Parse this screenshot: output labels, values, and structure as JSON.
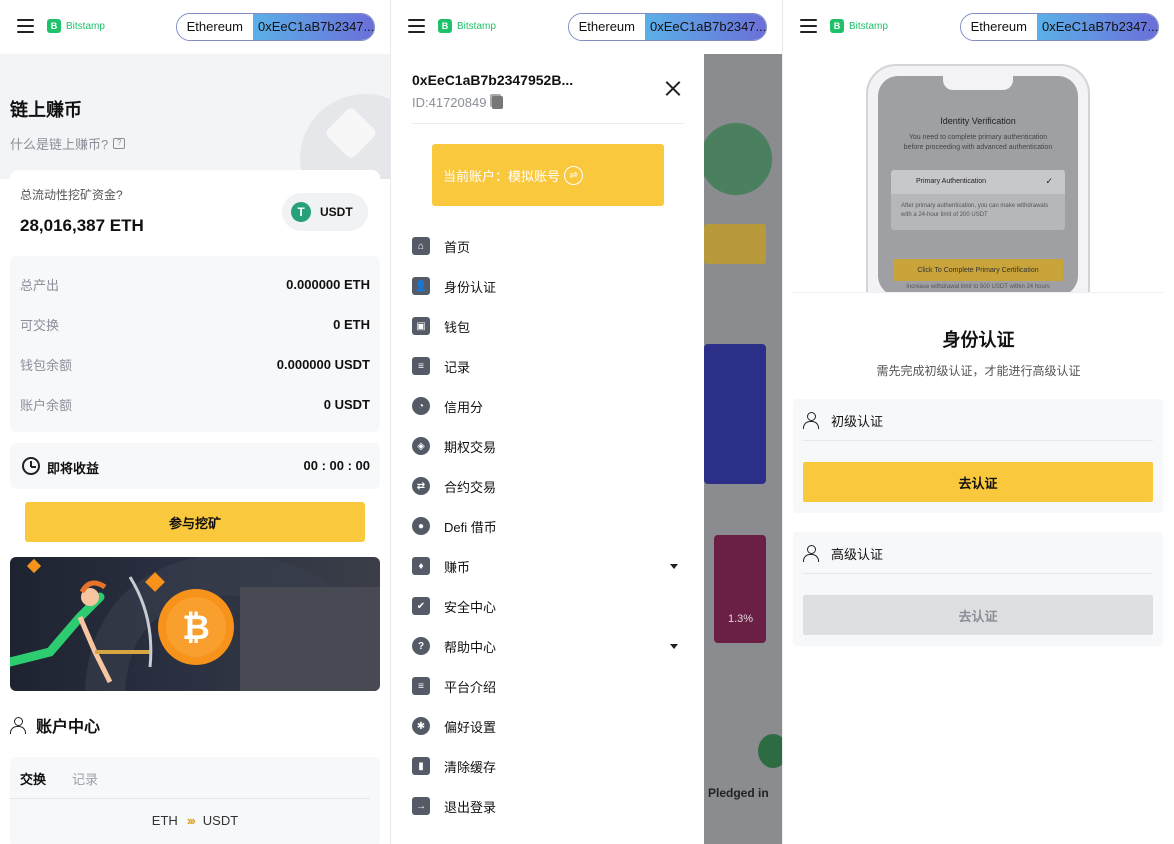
{
  "header": {
    "brand": "Bitstamp",
    "network": "Ethereum",
    "address_short": "0xEeC1aB7b2347..."
  },
  "mining": {
    "title": "链上赚币",
    "subtitle": "什么是链上赚币?",
    "pool_label": "总流动性挖矿资金?",
    "pool_value": "28,016,387 ETH",
    "coin": "USDT",
    "stats": [
      {
        "label": "总产出",
        "value": "0.000000 ETH"
      },
      {
        "label": "可交换",
        "value": "0 ETH"
      },
      {
        "label": "钱包余额",
        "value": "0.000000 USDT"
      },
      {
        "label": "账户余额",
        "value": "0 USDT"
      }
    ],
    "earn_label": "即将收益",
    "earn_timer": "00 : 00 : 00",
    "join_button": "参与挖矿",
    "account_center": "账户中心",
    "tabs": [
      "交换",
      "记录"
    ],
    "pair_from": "ETH",
    "pair_to": "USDT"
  },
  "drawer": {
    "address": "0xEeC1aB7b2347952B...",
    "id_text": "ID:41720849",
    "current_account": "当前账户：模拟账号",
    "menu": [
      {
        "label": "首页",
        "icon": "home-icon",
        "glyph": "⌂"
      },
      {
        "label": "身份认证",
        "icon": "identity-icon",
        "glyph": "👤"
      },
      {
        "label": "钱包",
        "icon": "wallet-icon",
        "glyph": "▣"
      },
      {
        "label": "记录",
        "icon": "record-icon",
        "glyph": "≡"
      },
      {
        "label": "信用分",
        "icon": "credit-gauge-icon",
        "glyph": "◔"
      },
      {
        "label": "期权交易",
        "icon": "options-icon",
        "glyph": "◈"
      },
      {
        "label": "合约交易",
        "icon": "contract-icon",
        "glyph": "⇄"
      },
      {
        "label": "Defi 借币",
        "icon": "defi-icon",
        "glyph": "●"
      },
      {
        "label": "赚币",
        "icon": "earn-icon",
        "glyph": "♦"
      },
      {
        "label": "安全中心",
        "icon": "shield-icon",
        "glyph": "✔"
      },
      {
        "label": "帮助中心",
        "icon": "help-icon",
        "glyph": "?"
      },
      {
        "label": "平台介绍",
        "icon": "intro-icon",
        "glyph": "≡"
      },
      {
        "label": "偏好设置",
        "icon": "gear-icon",
        "glyph": "✱"
      },
      {
        "label": "清除缓存",
        "icon": "trash-icon",
        "glyph": "▮"
      },
      {
        "label": "退出登录",
        "icon": "logout-icon",
        "glyph": "→"
      }
    ],
    "background_peek": {
      "percent": "1.3%",
      "pledged": "Pledged in"
    }
  },
  "identity": {
    "illustration": {
      "title": "Identity Verification",
      "desc": "You need to complete primary authentication before proceeding with advanced authentication",
      "auth_label": "Primary Authentication",
      "note": "After primary authentication, you can make withdrawals with a 24-hour limit of 200 USDT",
      "button": "Click To Complete Primary Certification",
      "button_note": "Increase withdrawal limit to 500 USDT within 24 hours"
    },
    "title": "身份认证",
    "subtitle": "需先完成初级认证，才能进行高级认证",
    "primary_label": "初级认证",
    "primary_button": "去认证",
    "advanced_label": "高级认证",
    "advanced_button": "去认证"
  },
  "colors": {
    "accent_yellow": "#f9c83d",
    "brand_green": "#1fc16b",
    "usdt_green": "#26a17b"
  }
}
